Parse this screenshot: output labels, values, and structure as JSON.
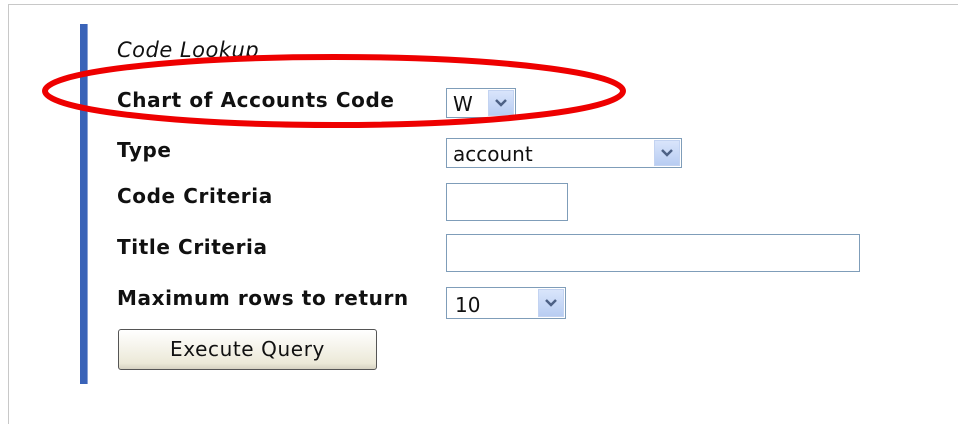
{
  "form": {
    "title": "Code Lookup",
    "fields": {
      "chart_of_accounts": {
        "label": "Chart of Accounts Code",
        "value": "W"
      },
      "type": {
        "label": "Type",
        "value": "account"
      },
      "code_criteria": {
        "label": "Code Criteria",
        "value": ""
      },
      "title_criteria": {
        "label": "Title Criteria",
        "value": ""
      },
      "max_rows": {
        "label": "Maximum rows to return",
        "value": "10"
      }
    },
    "execute_label": "Execute Query"
  },
  "colors": {
    "accent_bar": "#3a63b8",
    "highlight_ellipse": "#ee0000"
  }
}
